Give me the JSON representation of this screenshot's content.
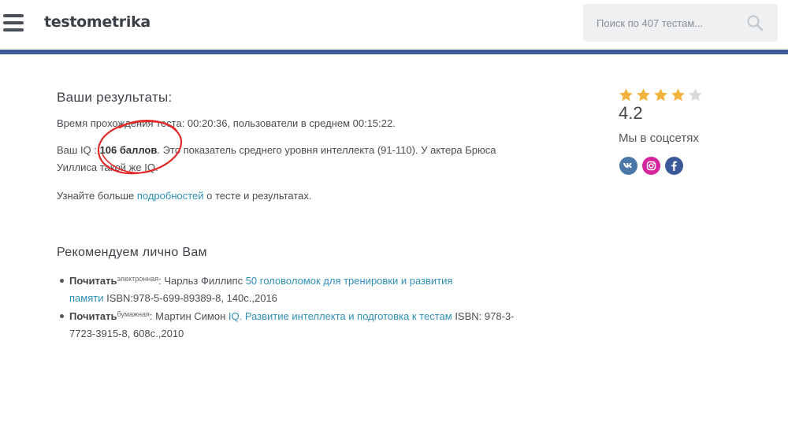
{
  "header": {
    "logo": "testometrika",
    "search_placeholder": "Поиск по 407 тестам...",
    "accent_color": "#3d5a96"
  },
  "results": {
    "title": "Ваши результаты:",
    "time_text": "Время прохождения теста: 00:20:36, пользователи в среднем 00:15:22.",
    "iq_prefix": "Ваш IQ : ",
    "iq_score": "106 баллов",
    "iq_line1_rest": ". Это показатель среднего уровня интеллекта (91-110). У актера Брюса",
    "iq_line2": "Уиллиса такой же IQ.",
    "more_prefix": "Узнайте больше ",
    "more_link": "подробностей",
    "more_suffix": " о тесте и результатах."
  },
  "recommend": {
    "title": "Рекомендуем лично Вам",
    "items": [
      {
        "label": "Почитать",
        "type": "электронная",
        "author": ": Чарльз Филлипс ",
        "book_line1": "50 головоломок для тренировки и развития",
        "book_line2": "памяти",
        "details": " ISBN:978-5-699-89389-8, 140с.,2016"
      },
      {
        "label": "Почитать",
        "type": "бумажная",
        "author": ": Мартин Симон ",
        "book": "IQ. Развитие интеллекта и подготовка к тестам",
        "details_line1": " ISBN: 978-3-",
        "details_line2": "7723-3915-8, 608с.,2010"
      }
    ]
  },
  "sidebar": {
    "rating": "4.2",
    "rating_value": 4.2,
    "stars_filled": 4,
    "stars_total": 5,
    "star_color": "#f3b23b",
    "star_empty_color": "#d9d9d9",
    "social_title": "Мы в соцсетях",
    "social": [
      {
        "icon": "vk-icon",
        "color": "#4a76a8"
      },
      {
        "icon": "instagram-icon",
        "color": "#d6249f"
      },
      {
        "icon": "facebook-icon",
        "color": "#3b5998"
      }
    ]
  }
}
